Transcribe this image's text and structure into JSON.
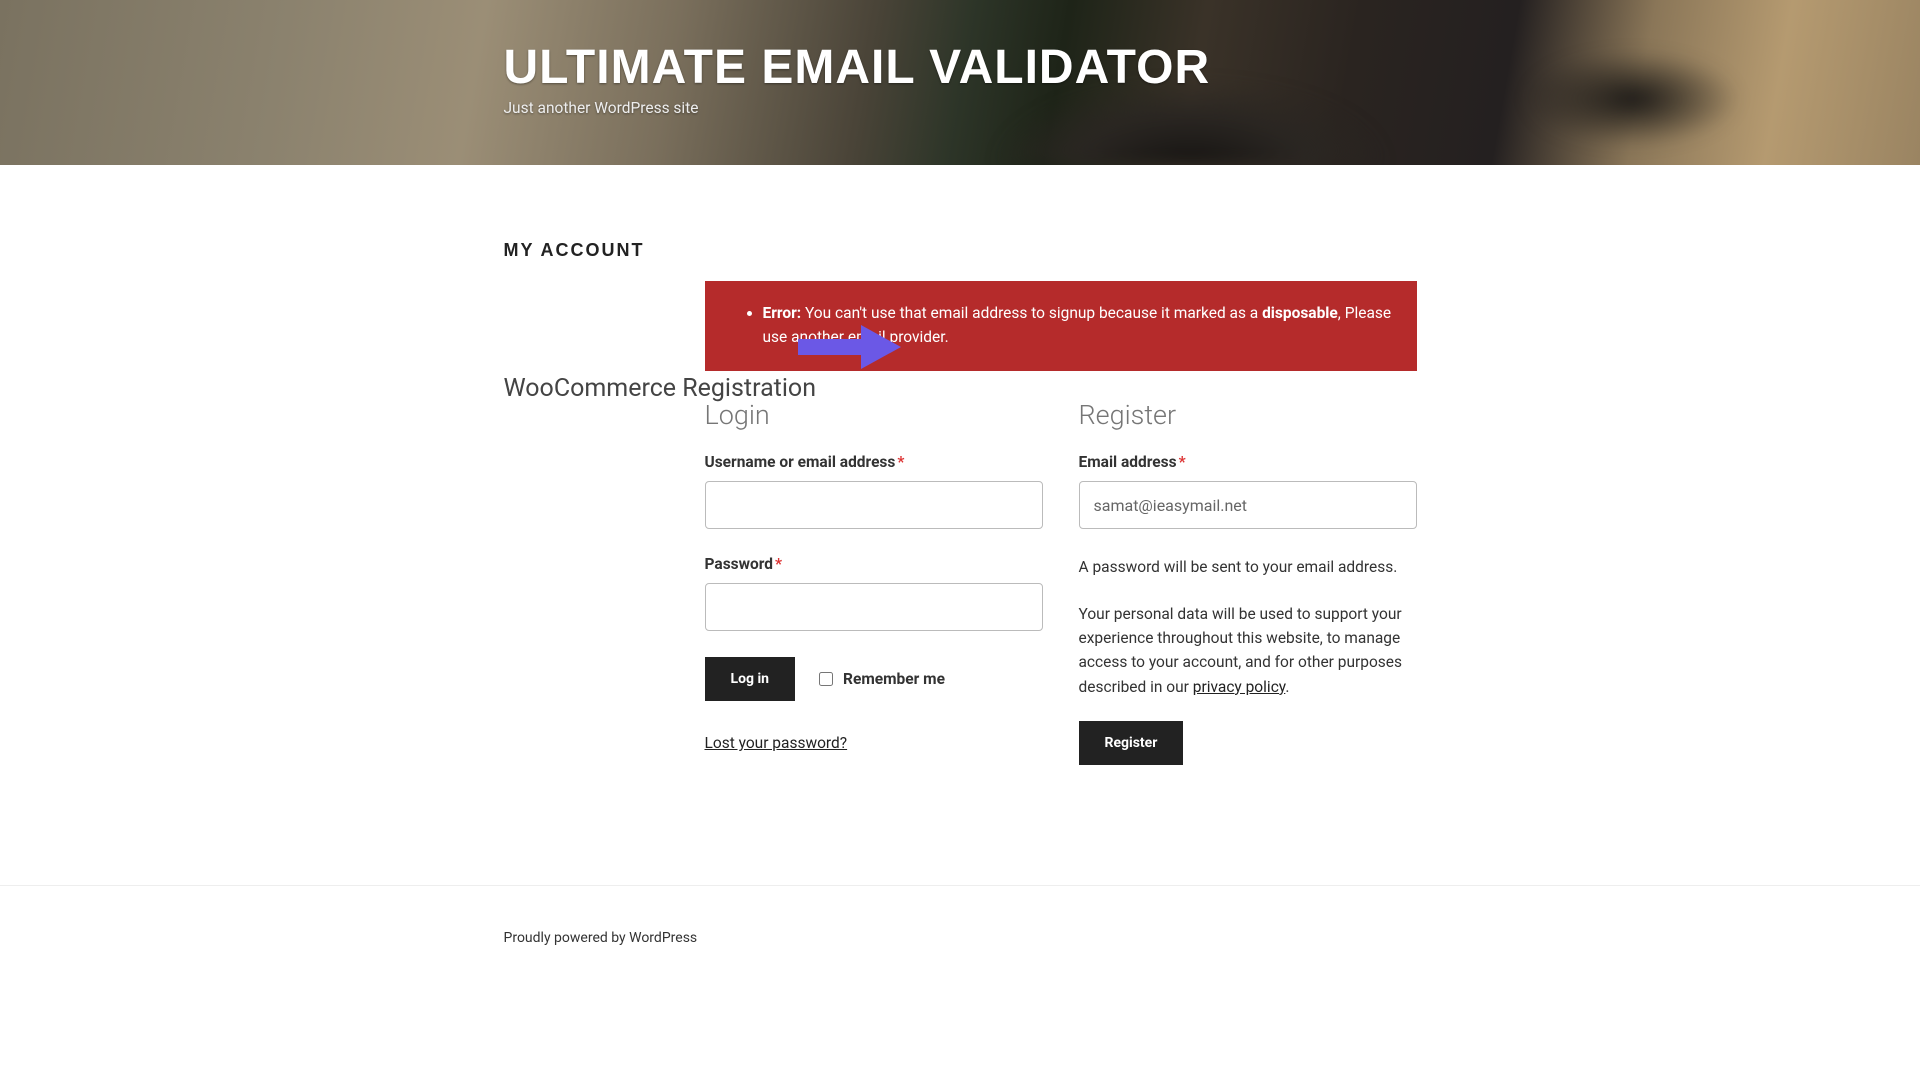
{
  "header": {
    "title": "ULTIMATE EMAIL VALIDATOR",
    "tagline": "Just another WordPress site"
  },
  "page": {
    "title": "MY ACCOUNT",
    "annotation": "WooCommerce Registration"
  },
  "error": {
    "label": "Error:",
    "part1": " You can't use that email address to signup because it marked as a ",
    "bold_word": "disposable",
    "part2": ", Please use another email provider."
  },
  "login": {
    "heading": "Login",
    "username_label": "Username or email address",
    "password_label": "Password",
    "button": "Log in",
    "remember": "Remember me",
    "lost_password": "Lost your password?"
  },
  "register": {
    "heading": "Register",
    "email_label": "Email address",
    "email_value": "samat@ieasymail.net",
    "password_note": "A password will be sent to your email address.",
    "privacy_text": "Your personal data will be used to support your experience throughout this website, to manage access to your account, and for other purposes described in our ",
    "privacy_link": "privacy policy",
    "button": "Register"
  },
  "footer": {
    "text": "Proudly powered by WordPress"
  },
  "colors": {
    "error_bg": "#b52b2b",
    "accent_arrow": "#6b58e6"
  }
}
